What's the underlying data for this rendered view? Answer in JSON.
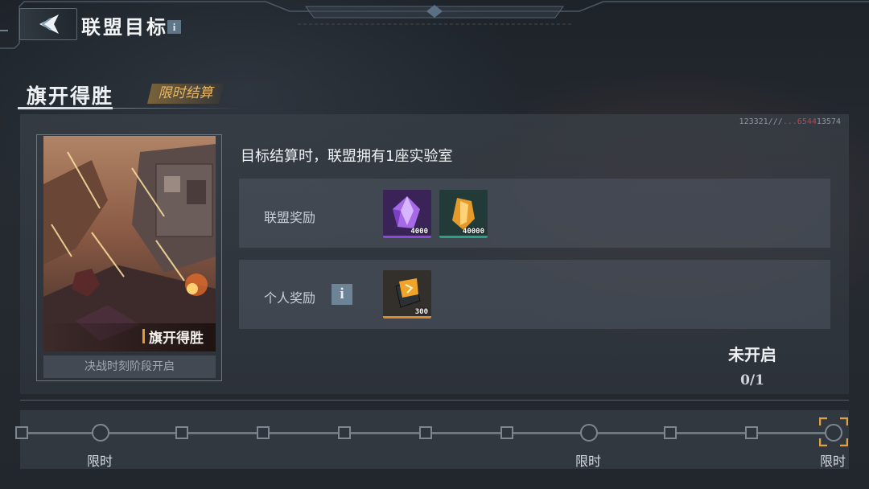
{
  "header": {
    "title": "联盟目标",
    "info_icon_glyph": "i"
  },
  "section": {
    "title": "旗开得胜",
    "badge": "限时结算"
  },
  "panel": {
    "code_left": "123321///",
    "code_red": "...6544",
    "code_right": "13574"
  },
  "card": {
    "name": "旗开得胜",
    "caption": "决战时刻阶段开启"
  },
  "objective": {
    "text": "目标结算时，联盟拥有1座实验室"
  },
  "rewards": {
    "alliance": {
      "label": "联盟奖励",
      "items": [
        {
          "icon": "purple-crystal-icon",
          "quantity": "4000",
          "color": "#8b4bd6"
        },
        {
          "icon": "orange-crystal-icon",
          "quantity": "40000",
          "color": "#2aa184"
        }
      ]
    },
    "personal": {
      "label": "个人奖励",
      "info_glyph": "i",
      "items": [
        {
          "icon": "orange-card-icon",
          "quantity": "300",
          "color": "#e0892a"
        }
      ]
    }
  },
  "status": {
    "state": "未开启",
    "progress": "0/1"
  },
  "timeline": {
    "labels": [
      "限时",
      "限时",
      "限时"
    ]
  },
  "colors": {
    "accent_orange": "#e8b764",
    "badge_bar": "#e79b2c"
  }
}
